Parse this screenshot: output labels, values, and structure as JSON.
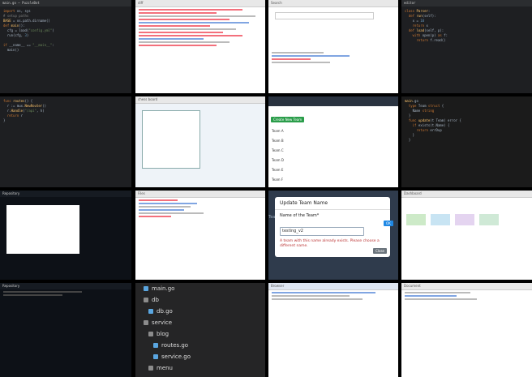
{
  "grid": {
    "c1": {
      "title": "main.go — PuzzleBot"
    },
    "c2": {
      "title": "diff"
    },
    "c3": {
      "title": "Search"
    },
    "c4": {
      "title": "editor"
    },
    "c5": {
      "title": "code"
    },
    "c6": {
      "title": "chess board"
    },
    "c7": {
      "header_btn": "Create New Team",
      "rows": [
        "Team A",
        "Team B",
        "Team C",
        "Team D",
        "Team E",
        "Team F"
      ]
    },
    "c8": {
      "title": "code"
    },
    "c9": {
      "title": "Repository"
    },
    "c10": {
      "title": "Files"
    },
    "modal": {
      "title": "Update Team Name",
      "label": "Name of the Team*",
      "value": "testing_v2",
      "ok": "OK",
      "error": "A team with this name already exists. Please choose a different name.",
      "close": "Close",
      "nav_left": "Team",
      "nav_left2": "Se"
    },
    "c12": {
      "title": "Dashboard"
    },
    "c13": {
      "title": "Repository"
    },
    "tree": [
      "main.go",
      "db",
      "db.go",
      "service",
      "blog",
      "routes.go",
      "service.go",
      "menu",
      "route.go"
    ],
    "c15": {
      "title": "Browser"
    },
    "c16": {
      "title": "Document"
    }
  }
}
